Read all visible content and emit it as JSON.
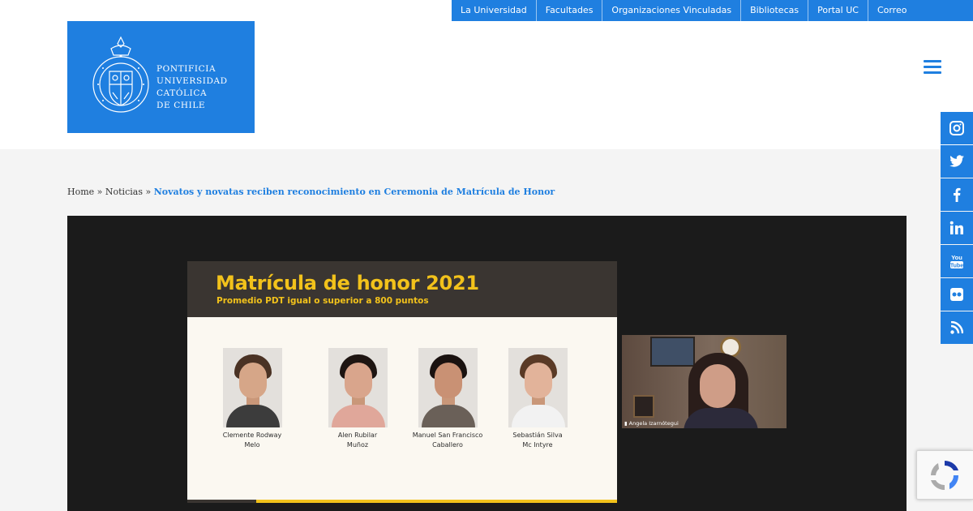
{
  "topbar": {
    "links": [
      "La Universidad",
      "Facultades",
      "Organizaciones Vinculadas",
      "Bibliotecas",
      "Portal UC",
      "Correo"
    ]
  },
  "logo": {
    "lines": [
      "PONTIFICIA",
      "UNIVERSIDAD",
      "CATÓLICA",
      "DE CHILE"
    ]
  },
  "breadcrumb": {
    "home": "Home",
    "separator": "»",
    "section": "Noticias",
    "current": "Novatos y novatas reciben reconocimiento en Ceremonia de Matrícula de Honor"
  },
  "slide": {
    "title": "Matrícula de honor 2021",
    "subtitle": "Promedio PDT igual o superior a 800 puntos",
    "students": [
      {
        "line1": "Clemente Rodway",
        "line2": "Melo"
      },
      {
        "line1": "Alen Rubilar",
        "line2": "Muñoz"
      },
      {
        "line1": "Manuel San Francisco",
        "line2": "Caballero"
      },
      {
        "line1": "Sebastián Silva",
        "line2": "Mc Intyre"
      }
    ],
    "webcam_label": "Angela Izarnótegui"
  },
  "social": [
    "instagram-icon",
    "twitter-icon",
    "facebook-icon",
    "linkedin-icon",
    "youtube-icon",
    "flickr-icon",
    "rss-icon"
  ],
  "colors": {
    "brand_blue": "#1f7fe0",
    "slide_yellow": "#f2c21b",
    "slide_dark": "#3a3531"
  }
}
